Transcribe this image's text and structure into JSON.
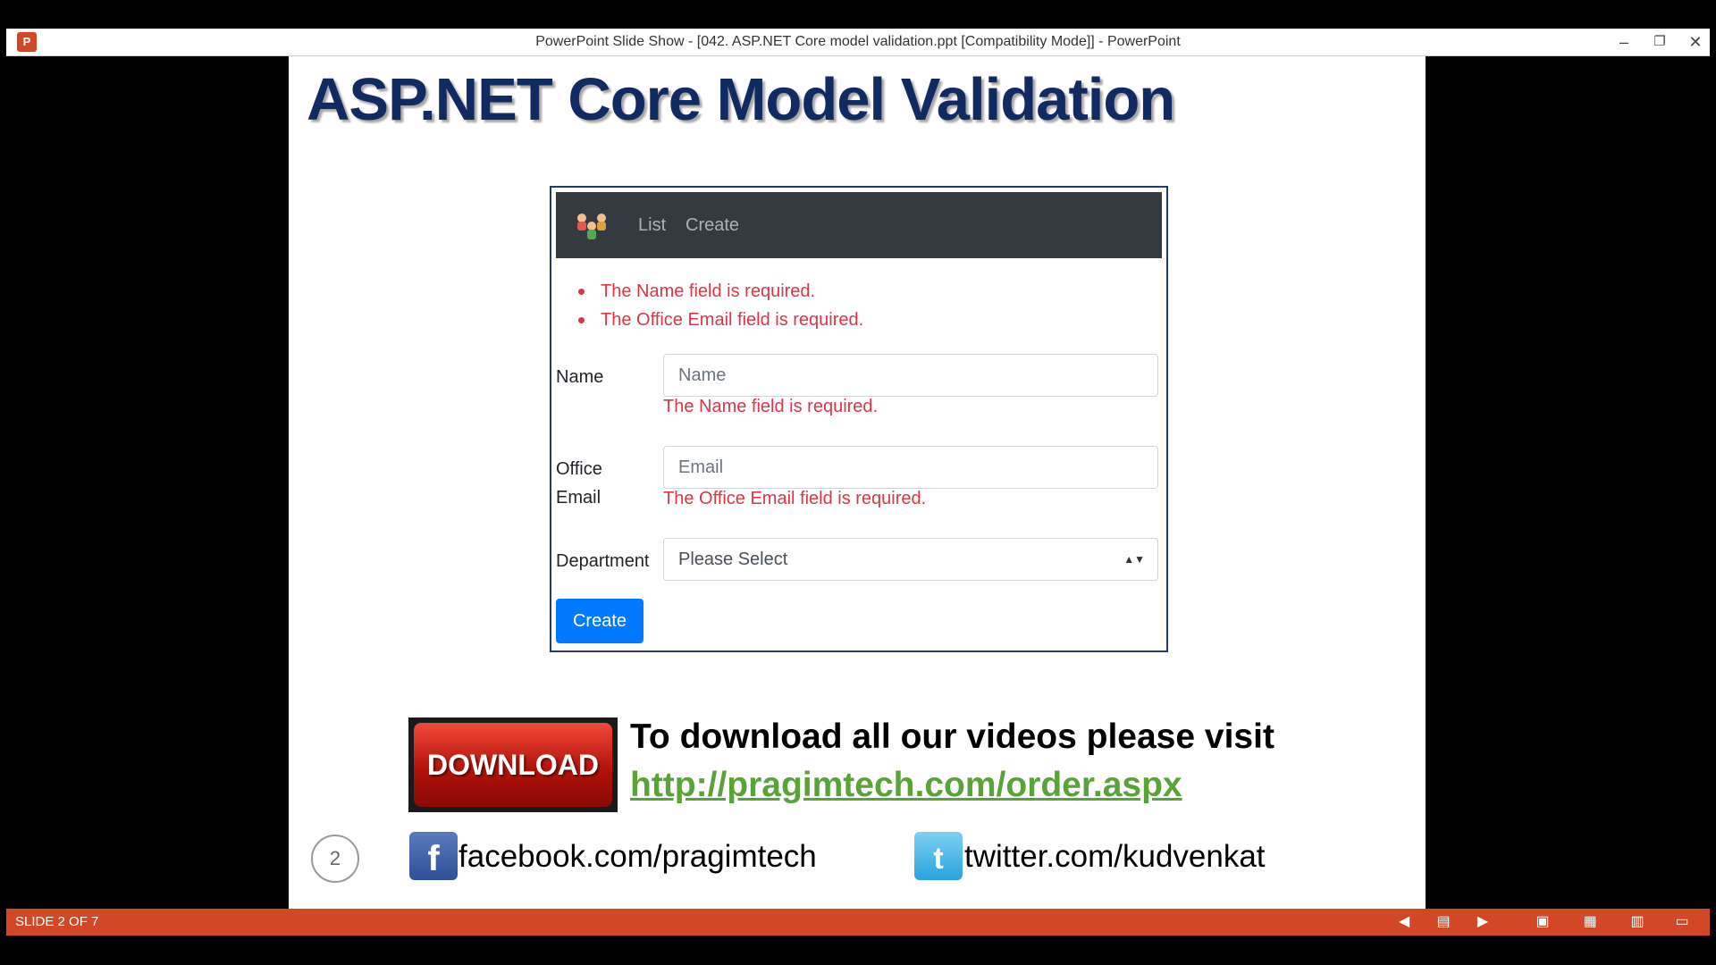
{
  "window": {
    "app_icon": "P",
    "title": "PowerPoint Slide Show - [042. ASP.NET Core model validation.ppt [Compatibility Mode]] - PowerPoint",
    "minimize": "–",
    "restore": "❐",
    "close": "✕"
  },
  "slide": {
    "title": "ASP.NET Core Model Validation",
    "app": {
      "nav": {
        "list": "List",
        "create": "Create"
      },
      "summary": [
        "The Name field is required.",
        "The Office Email field is required."
      ],
      "name_label": "Name",
      "name_placeholder": "Name",
      "name_error": "The Name field is required.",
      "email_label_line1": "Office",
      "email_label_line2": "Email",
      "email_placeholder": "Email",
      "email_error": "The Office Email field is required.",
      "department_label": "Department",
      "department_value": "Please Select",
      "create_button": "Create"
    },
    "promo": {
      "download_badge": "DOWNLOAD",
      "text": "To download all our videos please visit",
      "link": "http://pragimtech.com/order.aspx"
    },
    "slide_number": "2",
    "social": {
      "facebook": "facebook.com/pragimtech",
      "twitter": "twitter.com/kudvenkat"
    }
  },
  "statusbar": {
    "counter": "SLIDE 2 OF 7",
    "icons": [
      "previous-icon",
      "notes-icon",
      "next-icon",
      "normal-view-icon",
      "slide-sorter-icon",
      "reading-view-icon",
      "slide-show-icon"
    ]
  },
  "colors": {
    "title": "#102a62",
    "error": "#dc3545",
    "primary_button": "#007bff",
    "navbar": "#343a40",
    "link": "#5aa33a",
    "statusbar": "#d24726"
  }
}
